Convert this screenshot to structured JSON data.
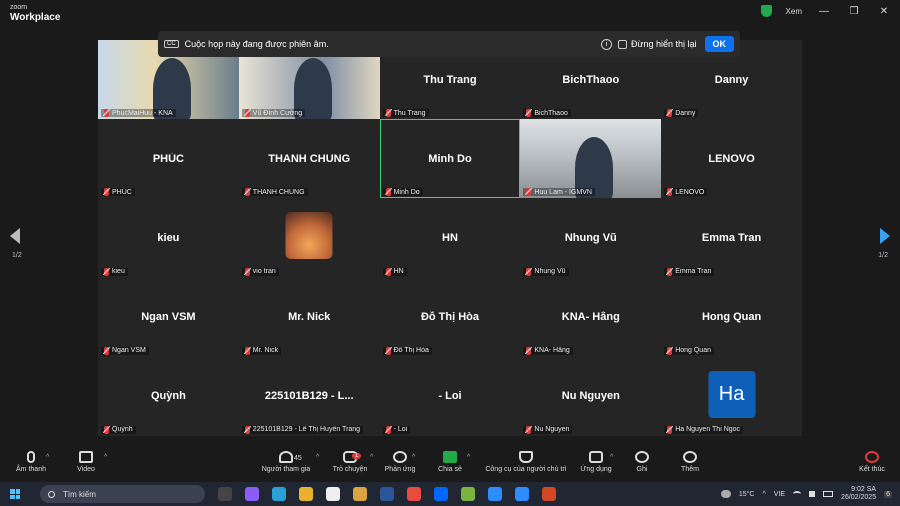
{
  "app": {
    "brand_small": "zoom",
    "brand_big": "Workplace"
  },
  "titlebar": {
    "view_label": "Xem",
    "minimize": "—",
    "restore": "❐",
    "close": "✕"
  },
  "notification": {
    "cc_icon": "CC",
    "message": "Cuộc họp này đang được phiên âm.",
    "info_icon": "i",
    "dont_show_label": "Đừng hiển thị lại",
    "ok_label": "OK"
  },
  "pagination": {
    "left": "1/2",
    "right": "1/2"
  },
  "participants": [
    {
      "name": "",
      "label": "PhucMaiHuu - KNA",
      "video": "vid1"
    },
    {
      "name": "",
      "label": "Vũ Đình Cường",
      "video": "vid2"
    },
    {
      "name": "Thu Trang",
      "label": "Thu Trang"
    },
    {
      "name": "BichThaoo",
      "label": "BichThaoo"
    },
    {
      "name": "Danny",
      "label": "Danny"
    },
    {
      "name": "PHÚC",
      "label": "PHÚC"
    },
    {
      "name": "THANH CHUNG",
      "label": "THANH CHUNG"
    },
    {
      "name": "Minh Do",
      "label": "Minh Do",
      "active": true
    },
    {
      "name": "",
      "label": "Huu Lam - IGMVN",
      "video": "vid3"
    },
    {
      "name": "LENOVO",
      "label": "LENOVO"
    },
    {
      "name": "kieu",
      "label": "kieu"
    },
    {
      "name": "",
      "label": "vio tran",
      "avatar": "image"
    },
    {
      "name": "HN",
      "label": "HN"
    },
    {
      "name": "Nhung Vũ",
      "label": "Nhung Vũ"
    },
    {
      "name": "Emma Tran",
      "label": "Emma Tran"
    },
    {
      "name": "Ngan VSM",
      "label": "Ngan VSM"
    },
    {
      "name": "Mr. Nick",
      "label": "Mr. Nick"
    },
    {
      "name": "Đỗ Thị Hòa",
      "label": "Đỗ Thị Hòa"
    },
    {
      "name": "KNA- Hằng",
      "label": "KNA- Hằng"
    },
    {
      "name": "Hong Quan",
      "label": "Hong Quan"
    },
    {
      "name": "Quỳnh",
      "label": "Quỳnh"
    },
    {
      "name": "225101B129 - L...",
      "label": "225101B129 - Lê Thị Huyền Trang"
    },
    {
      "name": "- Loi",
      "label": "- Loi"
    },
    {
      "name": "Nu Nguyen",
      "label": "Nu Nguyen"
    },
    {
      "name": "",
      "label": "Ha Nguyen Thi Ngoc",
      "avatar_text": "Ha"
    }
  ],
  "toolbar": {
    "audio": "Âm thanh",
    "video": "Video",
    "participants": "Người tham gia",
    "participants_count": "45",
    "chat": "Trò chuyện",
    "chat_badge": "1",
    "react": "Phản ứng",
    "share": "Chia sẻ",
    "host_tools": "Công cụ của người chủ trì",
    "apps": "Ứng dụng",
    "record": "Ghi",
    "more": "Thêm",
    "end": "Kết thúc"
  },
  "taskbar": {
    "search_placeholder": "Tìm kiếm",
    "temperature": "15°C",
    "language": "VIE",
    "time": "9:02 SA",
    "date": "26/02/2025",
    "notif_count": "6"
  },
  "colors": {
    "accent": "#0e72ed",
    "active_border": "#3fd07a",
    "mic_off": "#e03b3b",
    "share": "#21a94b"
  }
}
